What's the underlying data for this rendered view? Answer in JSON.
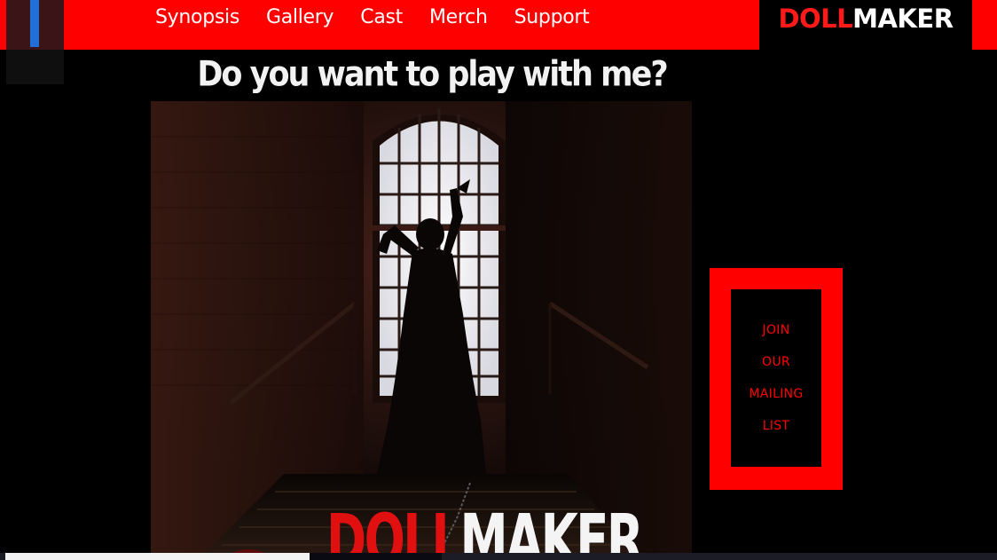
{
  "nav": {
    "items": [
      {
        "label": "Synopsis"
      },
      {
        "label": "Gallery"
      },
      {
        "label": "Cast"
      },
      {
        "label": "Merch"
      },
      {
        "label": "Support"
      }
    ]
  },
  "logo": {
    "part1": "DOLL",
    "part2": "MAKER"
  },
  "poster": {
    "tagline": "Do you want to play with me?",
    "title_part1": "DOLL",
    "title_part2": "MAKER"
  },
  "mailing": {
    "lines": [
      "JOIN",
      "OUR",
      "MAILING",
      "LIST"
    ]
  },
  "colors": {
    "accent": "#ff0000",
    "menu_stripe": "#1f6fd6",
    "background": "#000000"
  }
}
